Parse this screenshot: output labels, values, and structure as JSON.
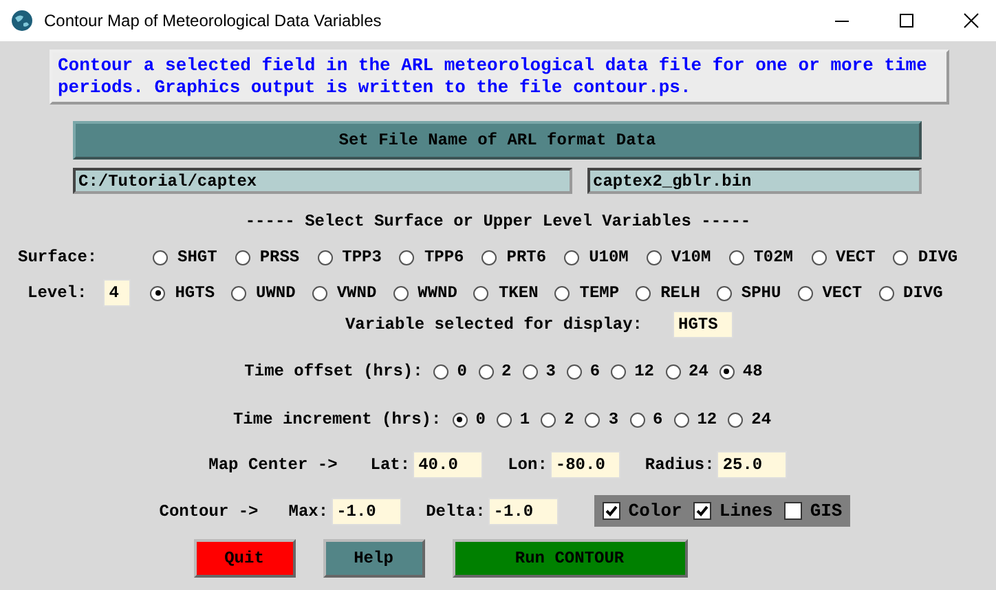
{
  "window": {
    "title": "Contour Map of Meteorological Data Variables"
  },
  "description": "Contour a selected field in the ARL meteorological data file for one or more time periods. Graphics output is written to the file contour.ps.",
  "file_button": "Set File Name of ARL format Data",
  "directory": "C:/Tutorial/captex",
  "file": "captex2_gblr.bin",
  "section_heading": "----- Select Surface or Upper Level Variables -----",
  "surface": {
    "label": "Surface:",
    "options": [
      {
        "label": "SHGT",
        "selected": false
      },
      {
        "label": "PRSS",
        "selected": false
      },
      {
        "label": "TPP3",
        "selected": false
      },
      {
        "label": "TPP6",
        "selected": false
      },
      {
        "label": "PRT6",
        "selected": false
      },
      {
        "label": "U10M",
        "selected": false
      },
      {
        "label": "V10M",
        "selected": false
      },
      {
        "label": "T02M",
        "selected": false
      },
      {
        "label": "VECT",
        "selected": false
      },
      {
        "label": "DIVG",
        "selected": false
      }
    ]
  },
  "level": {
    "label": "Level:",
    "value": "4",
    "options": [
      {
        "label": "HGTS",
        "selected": true
      },
      {
        "label": "UWND",
        "selected": false
      },
      {
        "label": "VWND",
        "selected": false
      },
      {
        "label": "WWND",
        "selected": false
      },
      {
        "label": "TKEN",
        "selected": false
      },
      {
        "label": "TEMP",
        "selected": false
      },
      {
        "label": "RELH",
        "selected": false
      },
      {
        "label": "SPHU",
        "selected": false
      },
      {
        "label": "VECT",
        "selected": false
      },
      {
        "label": "DIVG",
        "selected": false
      }
    ]
  },
  "variable_display": {
    "label": "Variable selected for display:",
    "value": "HGTS"
  },
  "time_offset": {
    "label": "Time offset (hrs):",
    "options": [
      {
        "label": "0",
        "selected": false
      },
      {
        "label": "2",
        "selected": false
      },
      {
        "label": "3",
        "selected": false
      },
      {
        "label": "6",
        "selected": false
      },
      {
        "label": "12",
        "selected": false
      },
      {
        "label": "24",
        "selected": false
      },
      {
        "label": "48",
        "selected": true
      }
    ]
  },
  "time_increment": {
    "label": "Time increment (hrs):",
    "options": [
      {
        "label": "0",
        "selected": true
      },
      {
        "label": "1",
        "selected": false
      },
      {
        "label": "2",
        "selected": false
      },
      {
        "label": "3",
        "selected": false
      },
      {
        "label": "6",
        "selected": false
      },
      {
        "label": "12",
        "selected": false
      },
      {
        "label": "24",
        "selected": false
      }
    ]
  },
  "map_center": {
    "label": "Map Center ->",
    "fields": [
      {
        "label": "Lat:",
        "value": "40.0"
      },
      {
        "label": "Lon:",
        "value": "-80.0"
      },
      {
        "label": "Radius:",
        "value": "25.0"
      }
    ]
  },
  "contour": {
    "label": "Contour ->",
    "fields": [
      {
        "label": "Max:",
        "value": "-1.0"
      },
      {
        "label": "Delta:",
        "value": "-1.0"
      }
    ],
    "checkboxes": [
      {
        "label": "Color",
        "checked": true
      },
      {
        "label": "Lines",
        "checked": true
      },
      {
        "label": "GIS",
        "checked": false
      }
    ]
  },
  "buttons": [
    {
      "label": "Quit",
      "color": "#ff0000"
    },
    {
      "label": "Help",
      "color": "#538587"
    },
    {
      "label": "Run CONTOUR",
      "color": "#008000"
    }
  ]
}
